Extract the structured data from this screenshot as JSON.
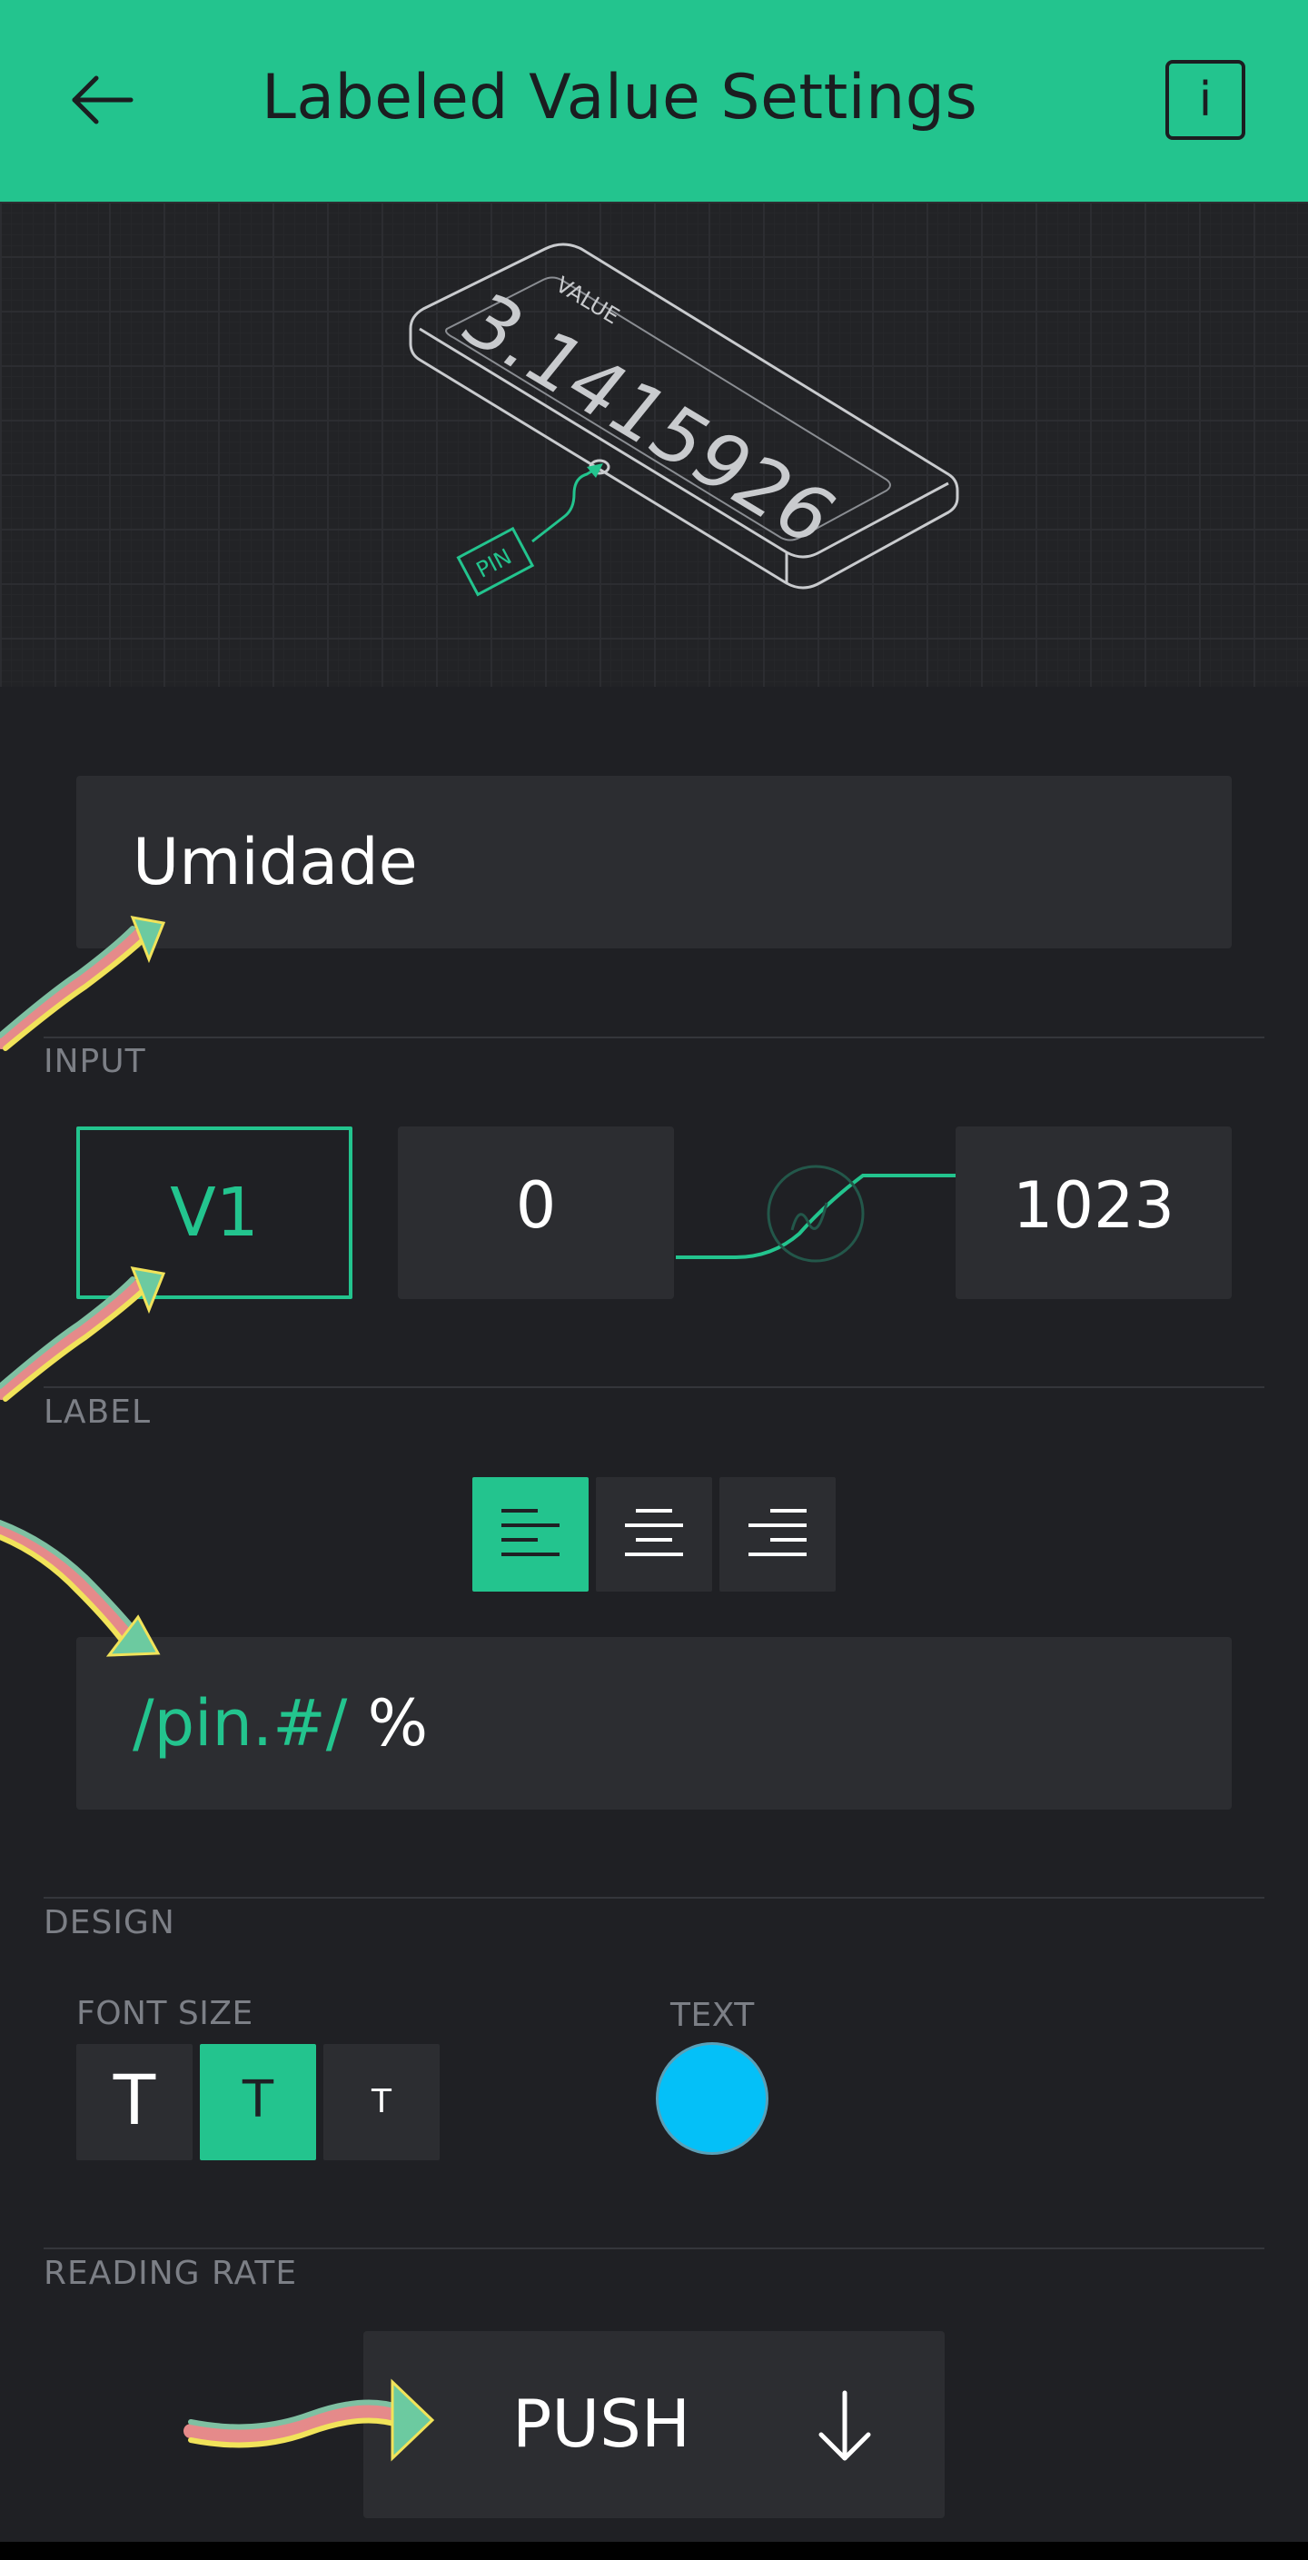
{
  "header": {
    "title": "Labeled Value Settings",
    "back_icon": "arrow-left-icon",
    "info_label": "i",
    "background": "#23c48e"
  },
  "preview": {
    "value_caption": "VALUE",
    "value_number": "3.1415926",
    "pin_caption": "PIN"
  },
  "name_field": {
    "value": "Umidade"
  },
  "input": {
    "section_label": "INPUT",
    "pin": "V1",
    "min": "0",
    "max": "1023"
  },
  "label": {
    "section_label": "LABEL",
    "alignment_options": [
      "left",
      "center",
      "right"
    ],
    "selected_alignment": "left",
    "pin_token": "/pin.#/",
    "suffix": "%"
  },
  "design": {
    "section_label": "DESIGN",
    "font_size_label": "FONT SIZE",
    "font_size_glyph": "T",
    "selected_font_size": "medium",
    "text_color_label": "TEXT",
    "text_color": "#04c0f8"
  },
  "reading_rate": {
    "section_label": "READING RATE",
    "value": "PUSH",
    "dropdown_icon": "arrow-down-icon"
  },
  "colors": {
    "accent": "#23c48e",
    "background": "#1f2024",
    "panel": "#2c2d31",
    "muted_text": "#7c7f86"
  }
}
